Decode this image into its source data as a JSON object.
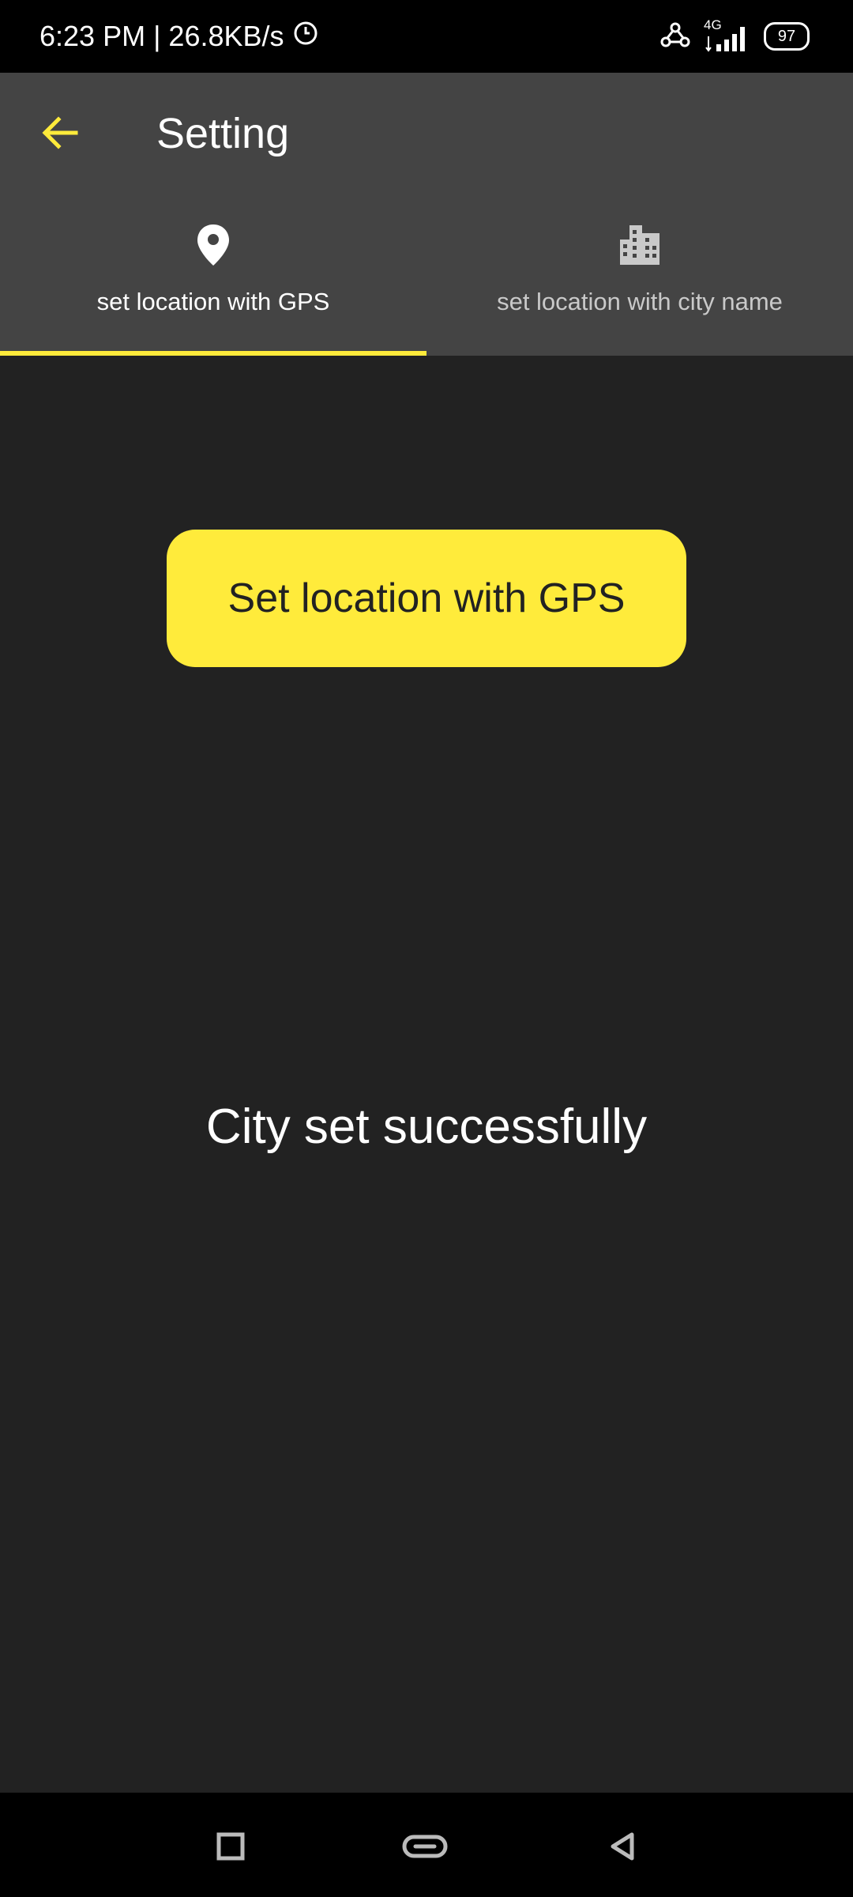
{
  "status_bar": {
    "time_speed": "6:23 PM | 26.8KB/s",
    "network_type": "4G",
    "battery": "97"
  },
  "app_bar": {
    "title": "Setting",
    "accent_color": "#ffeb3b"
  },
  "tabs": [
    {
      "label": "set location with GPS",
      "icon": "location-pin-icon",
      "selected": true
    },
    {
      "label": "set location with city name",
      "icon": "city-building-icon",
      "selected": false
    }
  ],
  "main": {
    "gps_button_label": "Set location with GPS",
    "status_message": "City set successfully"
  },
  "nav_bar": {
    "buttons": [
      "recents-icon",
      "home-icon",
      "back-icon"
    ]
  }
}
